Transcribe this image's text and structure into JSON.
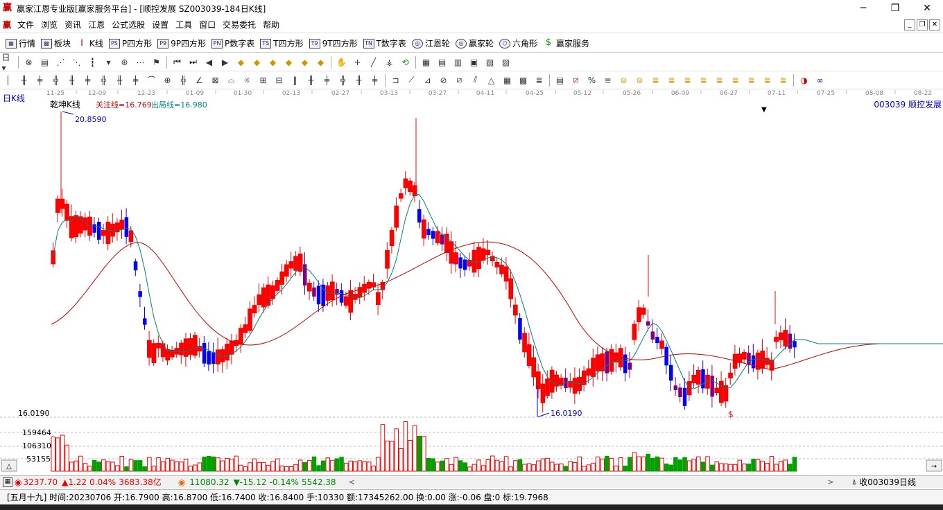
{
  "window": {
    "title": "赢家江恩专业版[赢家服务平台] - [顺控发展  SZ003039-184日K线]",
    "minimize": "─",
    "restore": "❐",
    "close": "✕"
  },
  "menu": {
    "items": [
      "文件",
      "浏览",
      "资讯",
      "江恩",
      "公式选股",
      "设置",
      "工具",
      "窗口",
      "交易委托",
      "帮助"
    ]
  },
  "toolbar1": {
    "items": [
      {
        "label": "行情",
        "icon": "grid-icon"
      },
      {
        "label": "板块",
        "icon": "blocks-icon"
      },
      {
        "label": "K线",
        "icon": "candlestick-icon"
      },
      {
        "label": "P四方形",
        "icon": "PS"
      },
      {
        "label": "9P四方形",
        "icon": "P9"
      },
      {
        "label": "P数字表",
        "icon": "PN"
      },
      {
        "label": "T四方形",
        "icon": "TS"
      },
      {
        "label": "9T四方形",
        "icon": "T9"
      },
      {
        "label": "T数字表",
        "icon": "TN"
      },
      {
        "label": "江恩轮",
        "icon": "wheel-icon"
      },
      {
        "label": "赢家轮",
        "icon": "wheel-icon"
      },
      {
        "label": "六角形",
        "icon": "hexagon-icon"
      },
      {
        "label": "赢家服务",
        "icon": "dollar-icon"
      }
    ]
  },
  "chart": {
    "period_label": "日K线",
    "indicator_name": "乾坤K线",
    "attention_line": "关注线=16.769",
    "exit_line": "出局线=16.980",
    "stock_label": "003039 顺控发展",
    "high_label": "20.8590",
    "low_label": "16.0190",
    "dollar_marker": "$",
    "dates": [
      "11-25",
      "12-09",
      "12-23",
      "01-09",
      "01-30",
      "02-13",
      "02-27",
      "03-13",
      "03-27",
      "04-11",
      "04-25",
      "05-12",
      "05-26",
      "06-09",
      "06-27",
      "07-11",
      "07-25",
      "08-08",
      "08-22"
    ],
    "volume_axis": [
      "16.0190",
      "159464",
      "106310",
      "53155"
    ],
    "colors": {
      "up": "#ff0000",
      "down": "#0000ff",
      "purple": "#800080",
      "ma_fast": "#008080",
      "ma_slow": "#cc0000",
      "volume": "#00a000"
    }
  },
  "status1": {
    "sh_index": "3237.70",
    "sh_change": "▲1.22",
    "sh_pct": "0.04%",
    "sh_amount": "3683.38亿",
    "sz_index": "11080.32",
    "sz_change": "▼-15.12",
    "sz_pct": "-0.14%",
    "sz_amount": "5542.38",
    "scroll_left": "<",
    "scroll_right": ">",
    "favorite": "收003039日线"
  },
  "status2": {
    "text": "[五月十九] 时间:20230706 开:16.7900 高:16.8700 低:16.7400 收:16.8400 手:10330 额:17345262.00 换:0.00 涨:-0.06 盘:0 标:19.7968"
  }
}
